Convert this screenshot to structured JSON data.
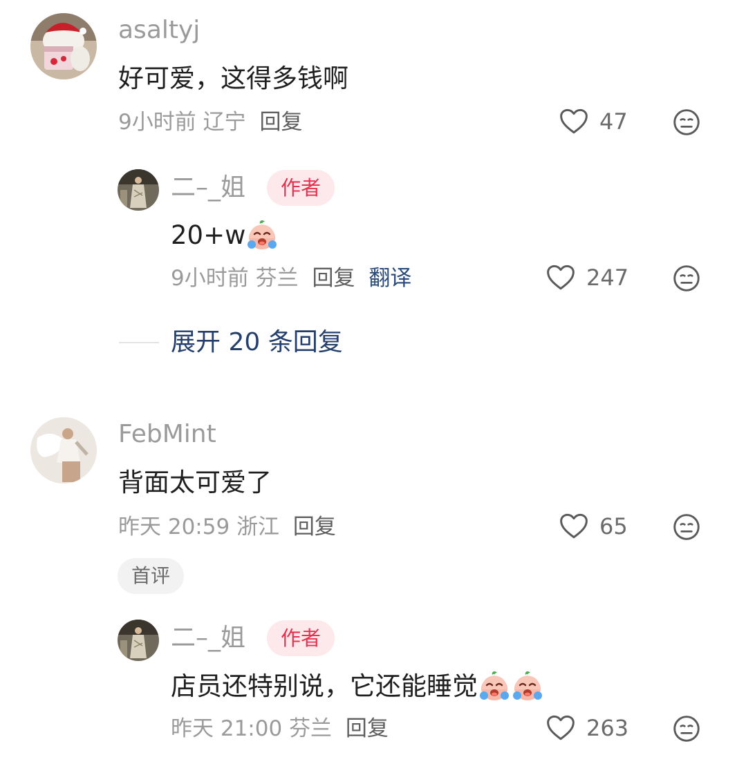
{
  "comments": [
    {
      "user": "asaltyj",
      "text": "好可爱，这得多钱啊",
      "time": "9小时前",
      "location": "辽宁",
      "reply_label": "回复",
      "likes": "47",
      "replies": [
        {
          "user": "二–_姐",
          "badge": "作者",
          "text": "20+w",
          "time": "9小时前",
          "location": "芬兰",
          "reply_label": "回复",
          "translate_label": "翻译",
          "likes": "247"
        }
      ],
      "expand_label": "展开 20 条回复"
    },
    {
      "user": "FebMint",
      "text": "背面太可爱了",
      "time": "昨天 20:59",
      "location": "浙江",
      "reply_label": "回复",
      "likes": "65",
      "tag": "首评",
      "replies": [
        {
          "user": "二–_姐",
          "badge": "作者",
          "text": "店员还特别说，它还能睡觉",
          "time": "昨天 21:00",
          "location": "芬兰",
          "reply_label": "回复",
          "likes": "263"
        }
      ]
    }
  ],
  "colors": {
    "author_badge_bg": "#fde8ec",
    "author_badge_text": "#e8314e",
    "expand_text": "#243f6b",
    "translate_text": "#2a4a7a"
  },
  "icons": [
    "avatar",
    "heart-icon",
    "meh-emoji-icon",
    "crying-emoji-icon"
  ]
}
